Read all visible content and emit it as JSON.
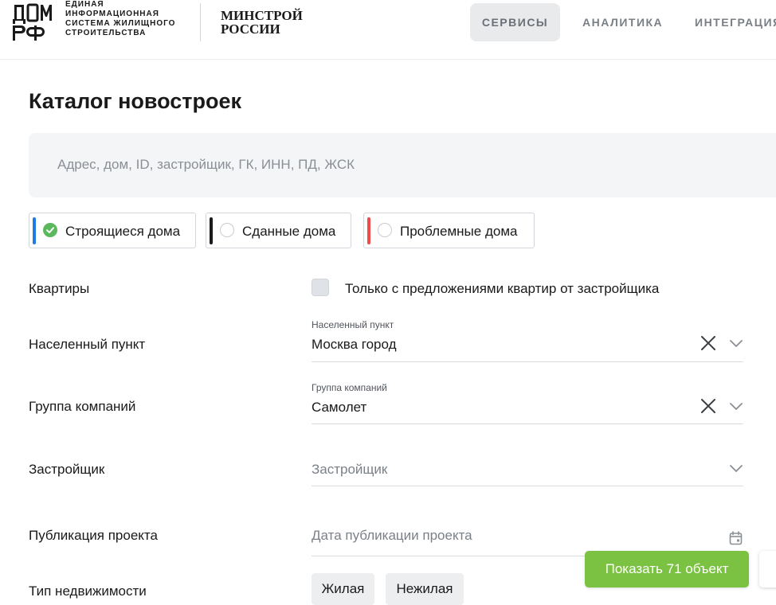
{
  "header": {
    "logo_text": "ДОМ РФ",
    "org_lines": [
      "ЕДИНАЯ",
      "ИНФОРМАЦИОННАЯ",
      "СИСТЕМА ЖИЛИЩНОГО",
      "СТРОИТЕЛЬСТВА"
    ],
    "ministry_lines": [
      "МИНСТРОЙ",
      "РОССИИ"
    ],
    "nav": [
      {
        "label": "СЕРВИСЫ",
        "active": true
      },
      {
        "label": "АНАЛИТИКА",
        "active": false
      },
      {
        "label": "ИНТЕГРАЦИЯ",
        "active": false
      }
    ]
  },
  "page": {
    "title": "Каталог новостроек"
  },
  "search": {
    "placeholder": "Адрес, дом, ID, застройщик, ГК, ИНН, ПД, ЖСК",
    "value": ""
  },
  "status_chips": [
    {
      "label": "Строящиеся дома",
      "checked": true,
      "color": "#1e7be6"
    },
    {
      "label": "Сданные дома",
      "checked": false,
      "color": "#1a1a1a"
    },
    {
      "label": "Проблемные дома",
      "checked": false,
      "color": "#ef4b4b"
    }
  ],
  "filters": {
    "apartments": {
      "label": "Квартиры",
      "checkbox_label": "Только с предложениями квартир от застройщика",
      "checked": false
    },
    "locality": {
      "label": "Населенный пункт",
      "caption": "Населенный пункт",
      "value": "Москва город",
      "clear_icon": "close-icon",
      "dropdown_icon": "chevron-down-icon"
    },
    "company_group": {
      "label": "Группа компаний",
      "caption": "Группа компаний",
      "value": "Самолет",
      "clear_icon": "close-icon",
      "dropdown_icon": "chevron-down-icon"
    },
    "developer": {
      "label": "Застройщик",
      "placeholder": "Застройщик",
      "dropdown_icon": "chevron-down-icon"
    },
    "publication": {
      "label": "Публикация проекта",
      "placeholder": "Дата публикации проекта",
      "icon": "calendar-icon"
    },
    "property_type": {
      "label": "Тип недвижимости",
      "options": [
        "Жилая",
        "Нежилая"
      ]
    }
  },
  "actions": {
    "show_button": "Показать 71 объект"
  },
  "colors": {
    "accent_green": "#7cc242",
    "check_green": "#5cb85c",
    "nav_active_bg": "#e9eaec",
    "search_bg": "#f4f5f6"
  }
}
